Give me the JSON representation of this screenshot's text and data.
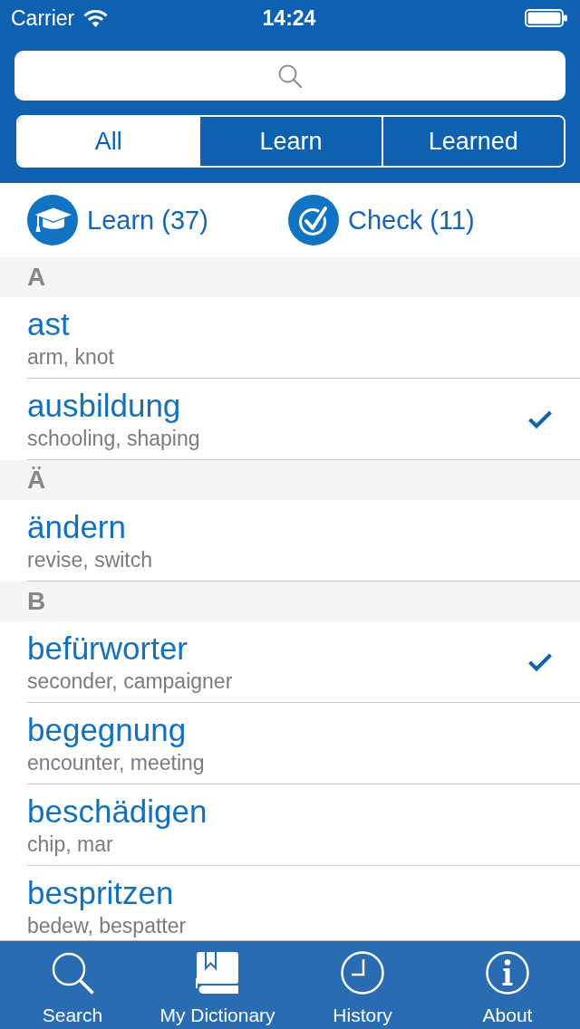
{
  "status_bar": {
    "carrier": "Carrier",
    "time": "14:24"
  },
  "filter_tabs": [
    {
      "label": "All",
      "selected": true
    },
    {
      "label": "Learn",
      "selected": false
    },
    {
      "label": "Learned",
      "selected": false
    }
  ],
  "actions": [
    {
      "kind": "learn",
      "label": "Learn (37)"
    },
    {
      "kind": "check",
      "label": "Check (11)"
    }
  ],
  "sections": [
    {
      "letter": "A",
      "entries": [
        {
          "word": "ast",
          "translation": "arm, knot",
          "learned": false
        },
        {
          "word": "ausbildung",
          "translation": "schooling, shaping",
          "learned": true
        }
      ]
    },
    {
      "letter": "Ä",
      "entries": [
        {
          "word": "ändern",
          "translation": "revise, switch",
          "learned": false
        }
      ]
    },
    {
      "letter": "B",
      "entries": [
        {
          "word": "befürworter",
          "translation": "seconder, campaigner",
          "learned": true
        },
        {
          "word": "begegnung",
          "translation": "encounter, meeting",
          "learned": false
        },
        {
          "word": "beschädigen",
          "translation": "chip, mar",
          "learned": false
        },
        {
          "word": "bespritzen",
          "translation": "bedew, bespatter",
          "learned": false
        }
      ]
    }
  ],
  "tab_bar": [
    {
      "kind": "search",
      "label": "Search",
      "selected": false
    },
    {
      "kind": "dictionary",
      "label": "My Dictionary",
      "selected": true
    },
    {
      "kind": "history",
      "label": "History",
      "selected": false
    },
    {
      "kind": "about",
      "label": "About",
      "selected": false
    }
  ]
}
